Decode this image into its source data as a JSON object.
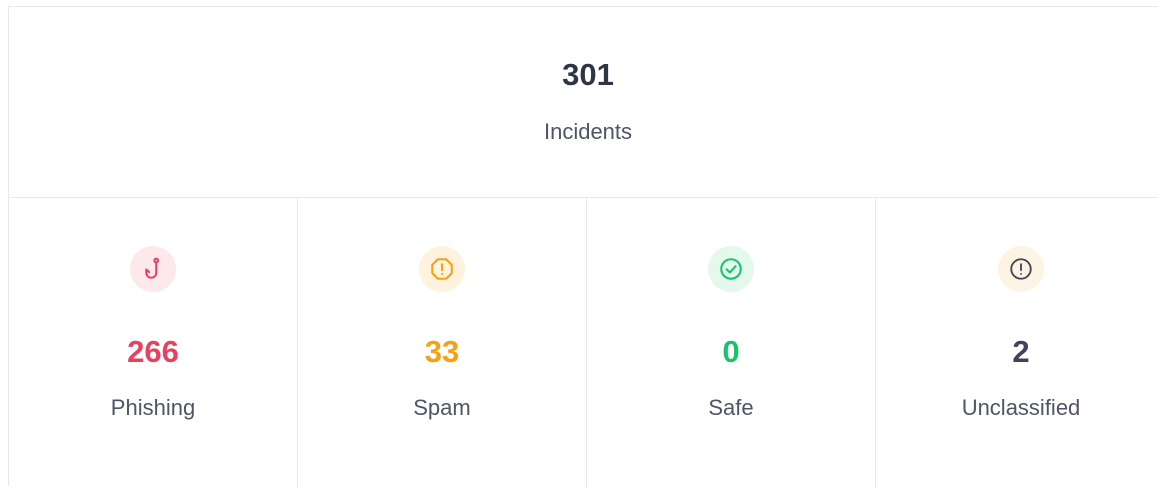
{
  "total": {
    "value": "301",
    "label": "Incidents"
  },
  "stats": [
    {
      "key": "phishing",
      "value": "266",
      "label": "Phishing",
      "icon": "fishhook-icon",
      "color": "#e8405e",
      "icon_bg": "#fde9ec"
    },
    {
      "key": "spam",
      "value": "33",
      "label": "Spam",
      "icon": "alert-octagon-icon",
      "color": "#f7a110",
      "icon_bg": "#fff3e0"
    },
    {
      "key": "safe",
      "value": "0",
      "label": "Safe",
      "icon": "check-circle-icon",
      "color": "#18c46b",
      "icon_bg": "#e4f8ec"
    },
    {
      "key": "unclassified",
      "value": "2",
      "label": "Unclassified",
      "icon": "alert-circle-icon",
      "color": "#3f4556",
      "icon_bg": "#fef4e4"
    }
  ]
}
